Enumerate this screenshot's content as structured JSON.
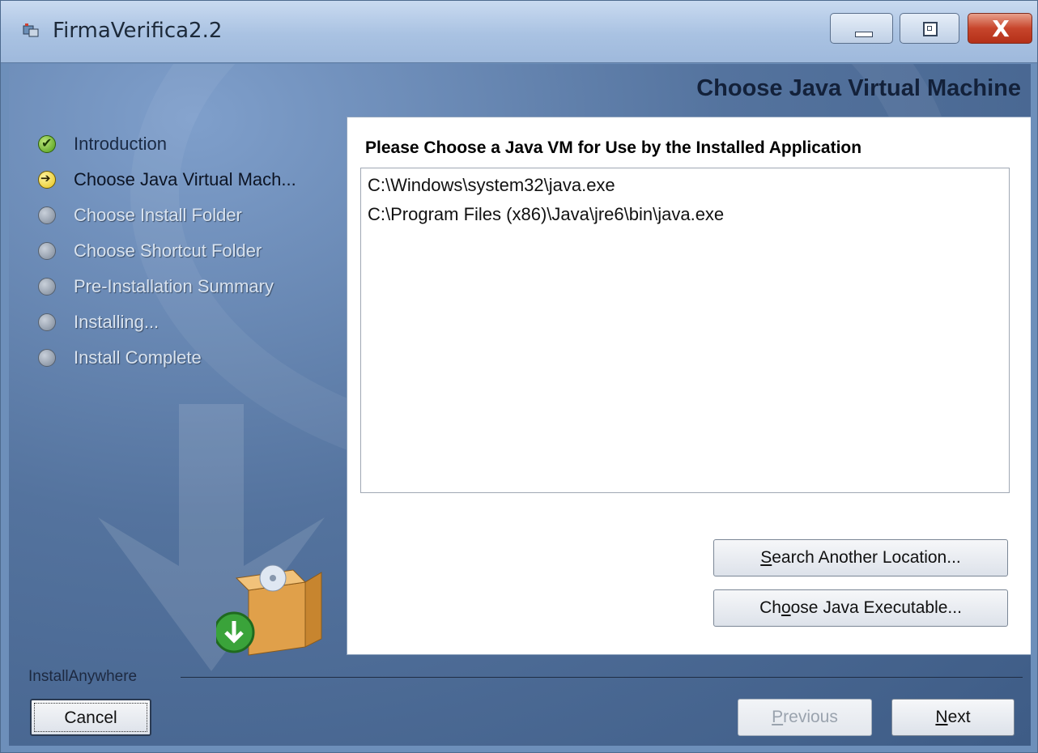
{
  "window": {
    "title": "FirmaVerifica2.2",
    "controls": {
      "close_glyph": "X"
    }
  },
  "installer": {
    "page_heading": "Choose Java Virtual Machine",
    "steps": [
      {
        "label": "Introduction",
        "state": "done",
        "icon": "check-icon"
      },
      {
        "label": "Choose Java Virtual Mach...",
        "state": "current",
        "icon": "arrow-icon"
      },
      {
        "label": "Choose Install Folder",
        "state": "pending",
        "icon": "pending-icon"
      },
      {
        "label": "Choose Shortcut Folder",
        "state": "pending",
        "icon": "pending-icon"
      },
      {
        "label": "Pre-Installation Summary",
        "state": "pending",
        "icon": "pending-icon"
      },
      {
        "label": "Installing...",
        "state": "pending",
        "icon": "pending-icon"
      },
      {
        "label": "Install Complete",
        "state": "pending",
        "icon": "pending-icon"
      }
    ],
    "panel": {
      "heading": "Please Choose a Java VM for Use by the Installed Application",
      "java_vms": [
        "C:\\Windows\\system32\\java.exe",
        "C:\\Program Files (x86)\\Java\\jre6\\bin\\java.exe"
      ],
      "search_button": {
        "mnemonic": "S",
        "rest": "earch Another Location..."
      },
      "choose_button": {
        "pre": "Ch",
        "mnemonic": "o",
        "rest": "ose Java Executable..."
      }
    },
    "footer": {
      "brand": "InstallAnywhere",
      "cancel_label": "Cancel",
      "previous": {
        "mnemonic": "P",
        "rest": "revious"
      },
      "next": {
        "mnemonic": "N",
        "rest": "ext"
      }
    }
  },
  "colors": {
    "title_bar": "#a9c2e2",
    "sidebar_bg": "#54739e",
    "close_button": "#c7452c",
    "panel_bg": "#ffffff"
  }
}
